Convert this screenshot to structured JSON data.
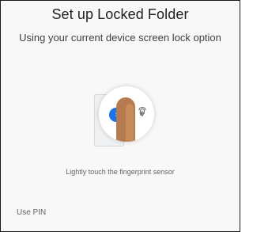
{
  "header": {
    "title": "Set up Locked Folder",
    "subtitle": "Using your current device screen lock option"
  },
  "illustration": {
    "finger_icon": "finger-touch-icon",
    "sensor_icon": "fingerprint-icon",
    "accent_color": "#1a73e8",
    "skin_color": "#b57a4d"
  },
  "instruction": "Lightly touch the fingerprint sensor",
  "actions": {
    "use_pin_label": "Use PIN"
  }
}
